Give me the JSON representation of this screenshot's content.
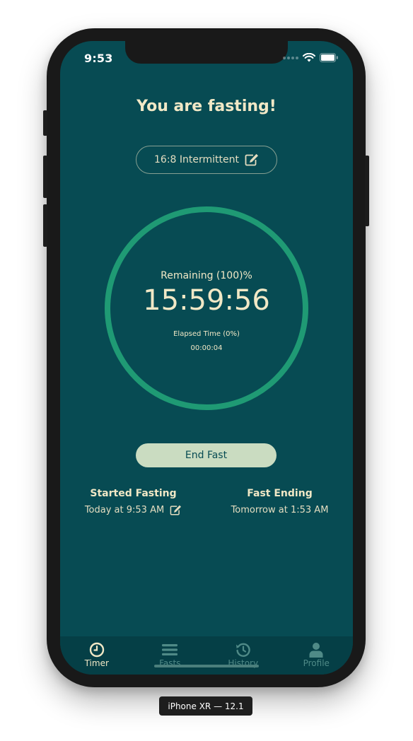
{
  "status_bar": {
    "time": "9:53"
  },
  "header": {
    "title": "You are fasting!"
  },
  "plan": {
    "label": "16:8 Intermittent",
    "edit_icon": "edit-icon"
  },
  "timer": {
    "remaining_label": "Remaining (100)%",
    "remaining_time": "15:59:56",
    "elapsed_label": "Elapsed Time (0%)",
    "elapsed_time": "00:00:04",
    "progress": 1.0,
    "ring_color": "#1f9a74"
  },
  "actions": {
    "end_fast_label": "End Fast"
  },
  "started": {
    "heading": "Started Fasting",
    "value": "Today at 9:53 AM"
  },
  "ending": {
    "heading": "Fast Ending",
    "value": "Tomorrow at 1:53 AM"
  },
  "tabs": [
    {
      "label": "Timer",
      "icon": "clock-icon",
      "active": true
    },
    {
      "label": "Fasts",
      "icon": "list-icon",
      "active": false
    },
    {
      "label": "History",
      "icon": "history-icon",
      "active": false
    },
    {
      "label": "Profile",
      "icon": "user-icon",
      "active": false
    }
  ],
  "simulator": {
    "label": "iPhone XR — 12.1"
  },
  "colors": {
    "background": "#074b53",
    "accent": "#1f9a74",
    "cream": "#f1e8c6",
    "button": "#cadcc1",
    "tabbar": "#053f46"
  }
}
